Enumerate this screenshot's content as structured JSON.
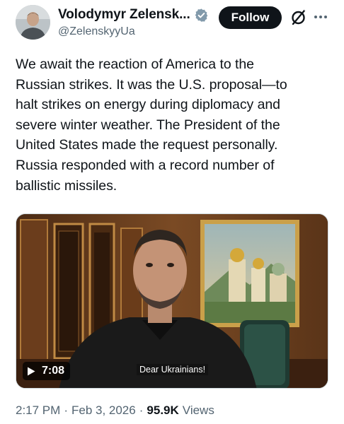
{
  "author": {
    "display_name": "Volodymyr Zelensk...",
    "handle": "@ZelenskyyUa",
    "verified": true,
    "badge_color": "#829aab"
  },
  "actions": {
    "follow_label": "Follow",
    "grok_icon": "grok-icon",
    "more_icon": "more-options-icon"
  },
  "tweet": {
    "lines": [
      "We await the reaction of America to the",
      "Russian strikes. It was the U.S. proposal—to",
      "halt strikes on energy during diplomacy and",
      "severe winter weather. The President of the",
      "United States made the request personally.",
      "Russia responded with a record number of",
      "ballistic missiles."
    ]
  },
  "media": {
    "type": "video",
    "duration": "7:08",
    "caption": "Dear Ukrainians!",
    "play_icon": "play-icon"
  },
  "meta": {
    "time": "2:17 PM",
    "date": "Feb 3, 2026",
    "separator": "·",
    "views_count": "95.9K",
    "views_label": "Views"
  },
  "colors": {
    "text_primary": "#0f1419",
    "text_secondary": "#536471",
    "follow_bg": "#0f1419"
  }
}
